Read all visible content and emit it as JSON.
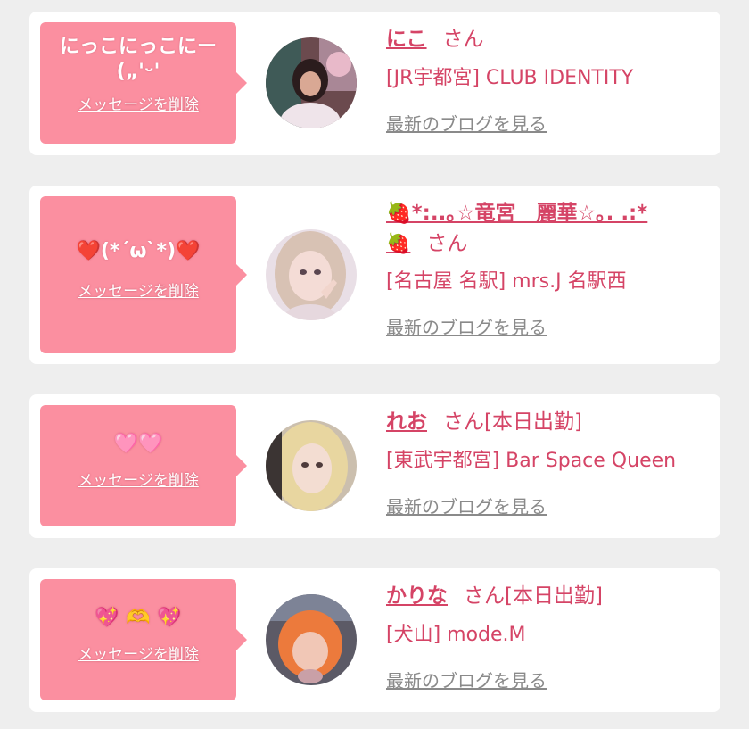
{
  "cards": [
    {
      "message": "にっこにっこにー\n(„'ᵕ'",
      "delete_label": "メッセージを削除",
      "name": "にこ",
      "suffix": "さん",
      "shop": "[JR宇都宮] CLUB IDENTITY",
      "blog_label": "最新のブログを見る"
    },
    {
      "message": "❤️(*´ω`*)❤️",
      "delete_label": "メッセージを削除",
      "name_line1": "🍓*:..｡☆竜宮　麗華☆｡. .:*",
      "name_line2": "🍓",
      "suffix": "さん",
      "shop": "[名古屋 名駅] mrs.J 名駅西",
      "blog_label": "最新のブログを見る"
    },
    {
      "message": "🩷🩷",
      "delete_label": "メッセージを削除",
      "name": "れお",
      "suffix": "さん[本日出勤]",
      "shop": "[東武宇都宮] Bar Space Queen",
      "blog_label": "最新のブログを見る"
    },
    {
      "message": "💖 🫶 💖",
      "delete_label": "メッセージを削除",
      "name": "かりな",
      "suffix": "さん[本日出勤]",
      "shop": "[犬山] mode.M",
      "blog_label": "最新のブログを見る"
    }
  ],
  "colors": {
    "background": "#eeeeee",
    "card": "#ffffff",
    "bubble": "#fb8fa0",
    "accent": "#d54466",
    "muted_link": "#8a8a8a"
  },
  "icons": {
    "avatar": "user-photo",
    "strawberry": "strawberry-emoji"
  }
}
